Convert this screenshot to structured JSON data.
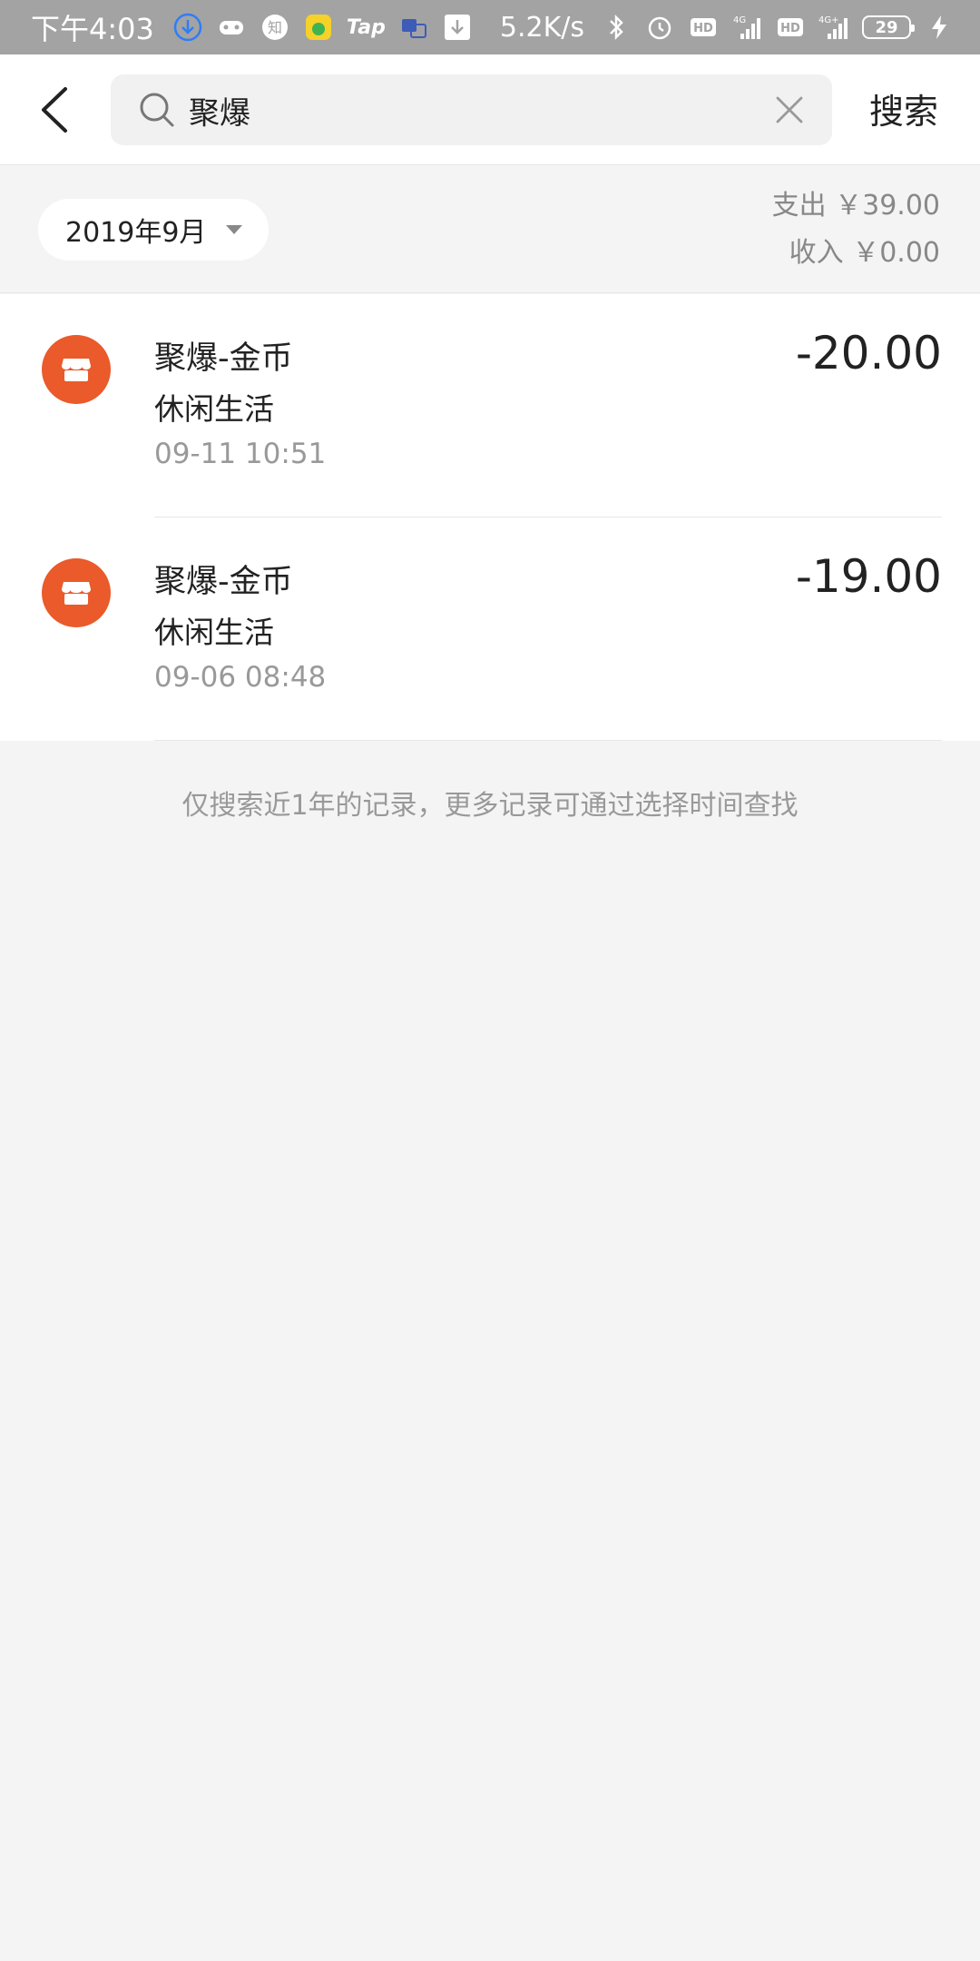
{
  "status_bar": {
    "time": "下午4:03",
    "notif_zhi": "知",
    "notif_tap": "Tap",
    "speed": "5.2K/s",
    "hd1": "HD",
    "net1": "4G",
    "hd2": "HD",
    "net2": "4G+",
    "battery": "29"
  },
  "search": {
    "value": "聚爆",
    "button_label": "搜索"
  },
  "filter": {
    "month": "2019年9月",
    "expense": "支出 ￥39.00",
    "income": "收入 ￥0.00"
  },
  "colors": {
    "accent": "#ea5a2a"
  },
  "transactions": [
    {
      "icon": "store-icon",
      "title": "聚爆-金币",
      "category": "休闲生活",
      "time": "09-11  10:51",
      "amount": "-20.00"
    },
    {
      "icon": "store-icon",
      "title": "聚爆-金币",
      "category": "休闲生活",
      "time": "09-06  08:48",
      "amount": "-19.00"
    }
  ],
  "footer_note": "仅搜索近1年的记录，更多记录可通过选择时间查找"
}
